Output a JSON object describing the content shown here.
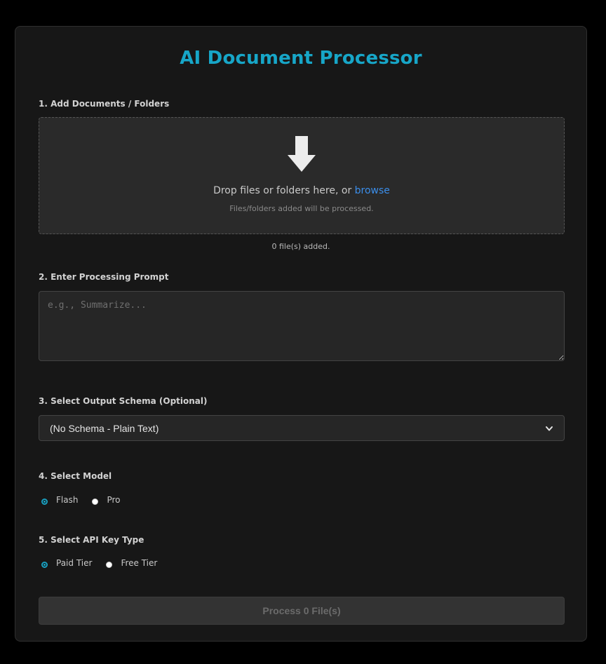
{
  "app": {
    "title": "AI Document Processor"
  },
  "documents": {
    "label": "1. Add Documents / Folders",
    "drop_text": "Drop files or folders here, or ",
    "browse_label": "browse",
    "hint": "Files/folders added will be processed.",
    "file_count": "0 file(s) added.",
    "icon": "download-arrow-icon"
  },
  "prompt": {
    "label": "2. Enter Processing Prompt",
    "placeholder": "e.g., Summarize...",
    "value": ""
  },
  "schema": {
    "label": "3. Select Output Schema (Optional)",
    "selected": "(No Schema - Plain Text)",
    "icon": "chevron-down-icon"
  },
  "model": {
    "label": "4. Select Model",
    "options": [
      {
        "label": "Flash",
        "checked": true
      },
      {
        "label": "Pro",
        "checked": false
      }
    ]
  },
  "api_key": {
    "label": "5. Select API Key Type",
    "options": [
      {
        "label": "Paid Tier",
        "checked": true
      },
      {
        "label": "Free Tier",
        "checked": false
      }
    ]
  },
  "process": {
    "label": "Process 0 File(s)",
    "disabled": true
  },
  "colors": {
    "accent": "#17a6c8",
    "link": "#3b8eea",
    "background": "#000000",
    "card": "#171717"
  }
}
